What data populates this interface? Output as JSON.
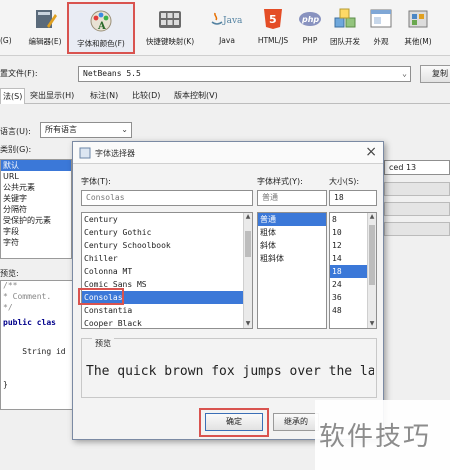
{
  "toolbar": {
    "items": [
      {
        "label": "(G)"
      },
      {
        "label": "编辑器(E)"
      },
      {
        "label": "字体和颜色(F)"
      },
      {
        "label": "快捷键映射(K)"
      },
      {
        "label": "Java"
      },
      {
        "label": "HTML/JS"
      },
      {
        "label": "PHP"
      },
      {
        "label": "团队开发"
      },
      {
        "label": "外观"
      },
      {
        "label": "其他(M)"
      }
    ],
    "icons": {
      "java_text": "Java",
      "html5_text": "5",
      "php_text": "php"
    },
    "accent": "#d9534f"
  },
  "profile": {
    "label": "置文件(F):",
    "value": "NetBeans 5.5",
    "copy_label": "复制"
  },
  "tabs": [
    "法(S)",
    "突出显示(H)",
    "标注(N)",
    "比较(D)",
    "版本控制(V)"
  ],
  "language": {
    "label": "语言(U):",
    "value": "所有语言"
  },
  "categories": {
    "label": "类别(G):",
    "items": [
      "默认",
      "URL",
      "公共元素",
      "关键字",
      "分隔符",
      "受保护的元素",
      "字段",
      "字符"
    ]
  },
  "right_snippet": "ced 13",
  "bg_preview": {
    "label": "预览:",
    "lines": [
      "/**",
      " * Comment.",
      " */",
      "public clas",
      "",
      "    String id",
      "",
      "}"
    ]
  },
  "dialog": {
    "title": "字体选择器",
    "close": "×",
    "font_label": "字体(T):",
    "font_value": "Consolas",
    "font_list": [
      "Century",
      "Century Gothic",
      "Century Schoolbook",
      "Chiller",
      "Colonna MT",
      "Comic Sans MS",
      "Consolas",
      "Constantia",
      "Cooper Black"
    ],
    "font_selected_index": 6,
    "style_label": "字体样式(Y):",
    "style_value": "普通",
    "style_list": [
      "普通",
      "粗体",
      "斜体",
      "粗斜体"
    ],
    "style_selected_index": 0,
    "size_label": "大小(S):",
    "size_value": "18",
    "size_list": [
      "8",
      "10",
      "12",
      "14",
      "18",
      "24",
      "36",
      "48"
    ],
    "size_selected_index": 4,
    "preview_label": "预览",
    "preview_text": "The quick brown fox jumps over the la",
    "ok_label": "确定",
    "inherit_label": "继承的"
  },
  "watermark": "软件技巧"
}
